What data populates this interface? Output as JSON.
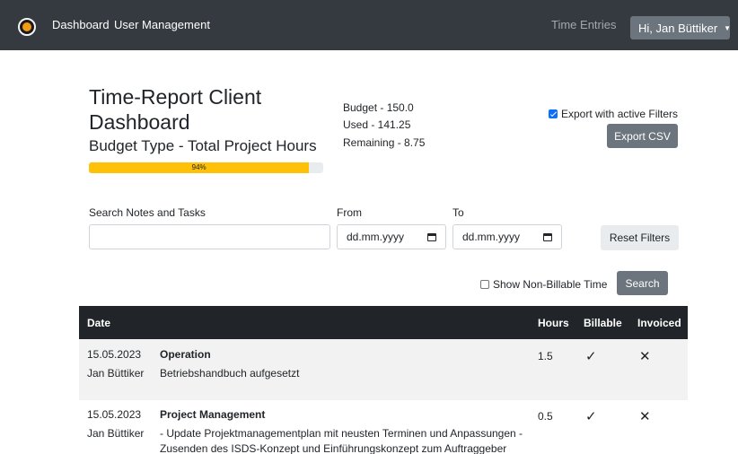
{
  "navbar": {
    "items": [
      {
        "label": "Dashboard"
      },
      {
        "label": "User Management"
      }
    ],
    "time_entries": "Time Entries",
    "user_greeting": "Hi, Jan Büttiker"
  },
  "header": {
    "title": "Time-Report Client Dashboard",
    "budget_type": "Budget Type - Total Project Hours",
    "progress": {
      "percent": 94,
      "label": "94%",
      "color": "#ffc107"
    },
    "budget": "Budget - 150.0",
    "used": "Used - 141.25",
    "remaining": "Remaining - 8.75"
  },
  "export": {
    "checkbox_label": "Export with active Filters",
    "checked": true,
    "button_label": "Export CSV"
  },
  "filters": {
    "search_label": "Search Notes and Tasks",
    "search_value": "",
    "from_label": "From",
    "from_placeholder": "dd.mm.yyyy",
    "to_label": "To",
    "to_placeholder": "dd.mm.yyyy",
    "reset_label": "Reset Filters",
    "non_billable_label": "Show Non-Billable Time",
    "non_billable_checked": false,
    "search_button": "Search"
  },
  "table": {
    "columns": [
      "Date",
      "Hours",
      "Billable",
      "Invoiced"
    ],
    "rows": [
      {
        "date": "15.05.2023",
        "user": "Jan Büttiker",
        "task": "Operation",
        "notes": [
          "Betriebshandbuch aufgesetzt"
        ],
        "hours": "1.5",
        "billable_icon": "check-icon",
        "invoiced_icon": "cross-icon"
      },
      {
        "date": "15.05.2023",
        "user": "Jan Büttiker",
        "task": "Project Management",
        "notes": [
          "- Update Projektmanagementplan mit neusten Terminen und Anpassungen -",
          "Zusenden des ISDS-Konzept und Einführungskonzept zum Auftraggeber"
        ],
        "hours": "0.5",
        "billable_icon": "check-icon",
        "invoiced_icon": "cross-icon"
      }
    ]
  },
  "colors": {
    "navbar": "#343a40",
    "table_header": "#212529",
    "button_secondary": "#6c757d",
    "progress": "#ffc107",
    "checkbox_accent": "#0d6efd"
  }
}
